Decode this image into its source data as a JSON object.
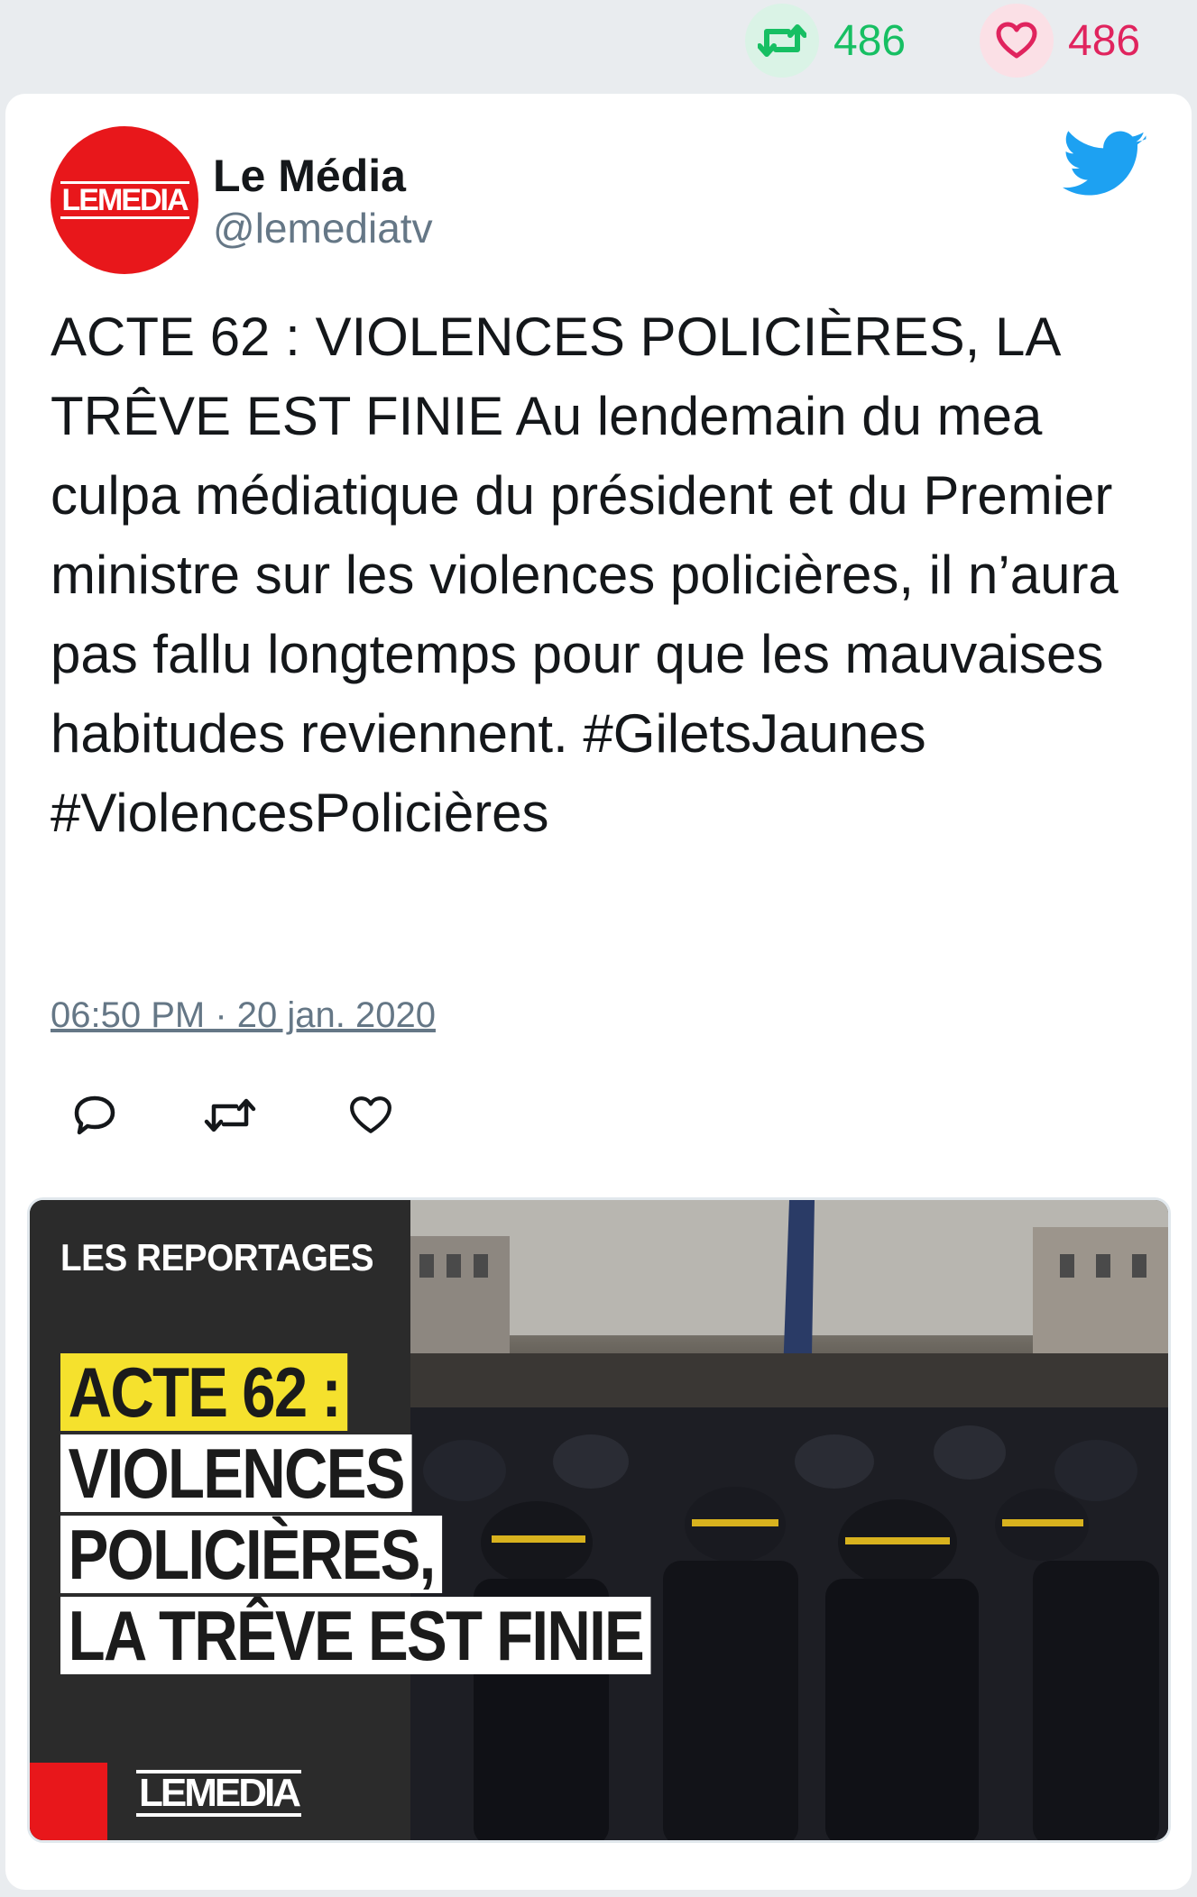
{
  "stats": {
    "retweet_count": "486",
    "like_count": "486",
    "retweet_icon": "retweet-icon",
    "like_icon": "heart-icon",
    "retweet_color": "#17bf63",
    "like_color": "#e0245e"
  },
  "tweet": {
    "author_name": "Le Média",
    "author_handle": "@lemediatv",
    "avatar_logo": "LEMEDIA",
    "text": "ACTE 62 : VIOLENCES POLICIÈRES, LA TRÊVE EST FINIE Au lendemain du mea culpa médiatique du président et du Premier ministre sur les violences policières, il n’aura pas fallu longtemps pour que les mauvaises habitudes reviennent. #GiletsJaunes #ViolencesPolicières",
    "timestamp": "06:50 PM · 20 jan. 2020",
    "brand_icon": "twitter-bird-icon",
    "brand_color": "#1da1f2"
  },
  "actions": {
    "reply_icon": "reply-icon",
    "retweet_icon": "retweet-icon",
    "like_icon": "heart-icon"
  },
  "media": {
    "kicker": "LES REPORTAGES",
    "headline_line1": "ACTE 62 :",
    "headline_line2": "VIOLENCES",
    "headline_line3": "POLICIÈRES,",
    "headline_line4": "LA TRÊVE EST FINIE",
    "logo": "LEMEDIA",
    "highlight_color": "#f5e12d"
  }
}
